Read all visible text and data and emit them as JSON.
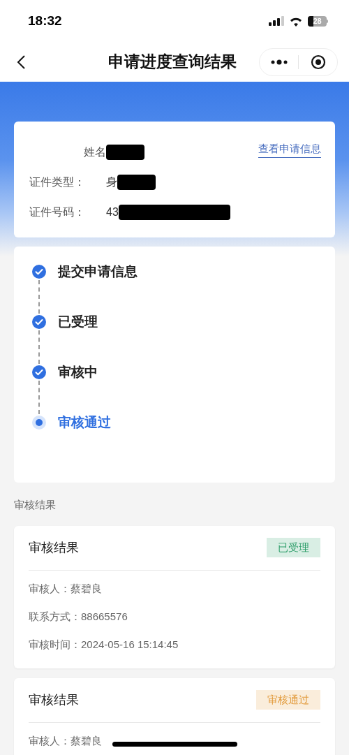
{
  "status_bar": {
    "time": "18:32",
    "battery": "28"
  },
  "nav": {
    "title": "申请进度查询结果"
  },
  "applicant": {
    "link": "查看申请信息",
    "fields": [
      {
        "label": "姓名",
        "redacted": true
      },
      {
        "label": "证件类型：",
        "value": "身",
        "redacted": true
      },
      {
        "label": "证件号码：",
        "value": "43",
        "redacted": true
      }
    ]
  },
  "steps": [
    {
      "label": "提交申请信息",
      "kind": "done"
    },
    {
      "label": "已受理",
      "kind": "done"
    },
    {
      "label": "审核中",
      "kind": "done"
    },
    {
      "label": "审核通过",
      "kind": "current"
    }
  ],
  "section_title": "审核结果",
  "results": [
    {
      "title": "审核结果",
      "tag": "已受理",
      "color": "#2e9e6a",
      "rows": [
        "审核人：蔡碧良",
        "联系方式：88665576",
        "审核时间：2024-05-16 15:14:45"
      ]
    },
    {
      "title": "审核结果",
      "tag": "审核通过",
      "color": "#e29a3a",
      "rows": [
        "审核人：蔡碧良"
      ]
    }
  ]
}
